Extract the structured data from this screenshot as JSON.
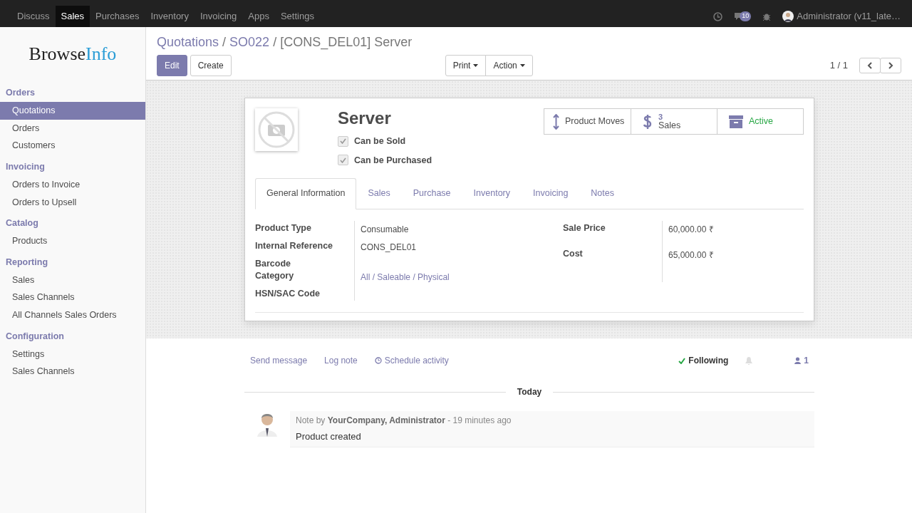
{
  "top_menu": [
    {
      "label": "Discuss",
      "selected": false
    },
    {
      "label": "Sales",
      "selected": true
    },
    {
      "label": "Purchases",
      "selected": false
    },
    {
      "label": "Inventory",
      "selected": false
    },
    {
      "label": "Invoicing",
      "selected": false
    },
    {
      "label": "Apps",
      "selected": false
    },
    {
      "label": "Settings",
      "selected": false
    }
  ],
  "systray": {
    "message_count": "10",
    "user": "Administrator (v11_late…"
  },
  "logo": {
    "part_1": "Browse",
    "part_2": "Info"
  },
  "sidebar": [
    {
      "title": "Orders",
      "items": [
        {
          "label": "Quotations",
          "selected": true
        },
        {
          "label": "Orders",
          "selected": false
        },
        {
          "label": "Customers",
          "selected": false
        }
      ]
    },
    {
      "title": "Invoicing",
      "items": [
        {
          "label": "Orders to Invoice",
          "selected": false
        },
        {
          "label": "Orders to Upsell",
          "selected": false
        }
      ]
    },
    {
      "title": "Catalog",
      "items": [
        {
          "label": "Products",
          "selected": false
        }
      ]
    },
    {
      "title": "Reporting",
      "items": [
        {
          "label": "Sales",
          "selected": false
        },
        {
          "label": "Sales Channels",
          "selected": false
        },
        {
          "label": "All Channels Sales Orders",
          "selected": false
        }
      ]
    },
    {
      "title": "Configuration",
      "items": [
        {
          "label": "Settings",
          "selected": false
        },
        {
          "label": "Sales Channels",
          "selected": false
        }
      ]
    }
  ],
  "breadcrumbs": [
    {
      "label": "Quotations",
      "separator": "/",
      "current": false
    },
    {
      "label": "SO022",
      "separator": "/",
      "current": false
    },
    {
      "label": "[CONS_DEL01] Server",
      "current": true
    }
  ],
  "buttons": {
    "edit": "Edit",
    "create": "Create",
    "print": "Print",
    "action": "Action"
  },
  "pager": "1 / 1",
  "product": {
    "name": "Server",
    "checkboxes": [
      {
        "label": "Can be Sold",
        "checked": true
      },
      {
        "label": "Can be Purchased",
        "checked": true
      }
    ],
    "smart_buttons": [
      {
        "kind": "moves",
        "label": "Product Moves"
      },
      {
        "kind": "sales",
        "count": "3",
        "label": "Sales"
      },
      {
        "kind": "active",
        "label": "Active"
      }
    ],
    "tabs": [
      {
        "label": "General Information",
        "selected": true
      },
      {
        "label": "Sales",
        "selected": false
      },
      {
        "label": "Purchase",
        "selected": false
      },
      {
        "label": "Inventory",
        "selected": false
      },
      {
        "label": "Invoicing",
        "selected": false
      },
      {
        "label": "Notes",
        "selected": false
      }
    ],
    "left_fields": [
      {
        "label": "Product Type",
        "value": "Consumable",
        "kind": "text"
      },
      {
        "label": "Internal Reference",
        "value": "CONS_DEL01",
        "kind": "text"
      },
      {
        "label": "Barcode"
      },
      {
        "label": "Category",
        "value": "All / Saleable / Physical",
        "kind": "link"
      },
      {
        "label": "HSN/SAC Code"
      }
    ],
    "right_fields": [
      {
        "label": "Sale Price",
        "value": "60,000.00 ₹"
      },
      {
        "label": "Cost",
        "value": "65,000.00 ₹"
      }
    ]
  },
  "chatter": {
    "actions": [
      "Send message",
      "Log note",
      "Schedule activity"
    ],
    "following": "Following",
    "followers": "1",
    "date": "Today",
    "messages": [
      {
        "prefix": "Note by",
        "author": "YourCompany, Administrator",
        "time": "- 19 minutes ago",
        "body": "Product created"
      }
    ]
  }
}
